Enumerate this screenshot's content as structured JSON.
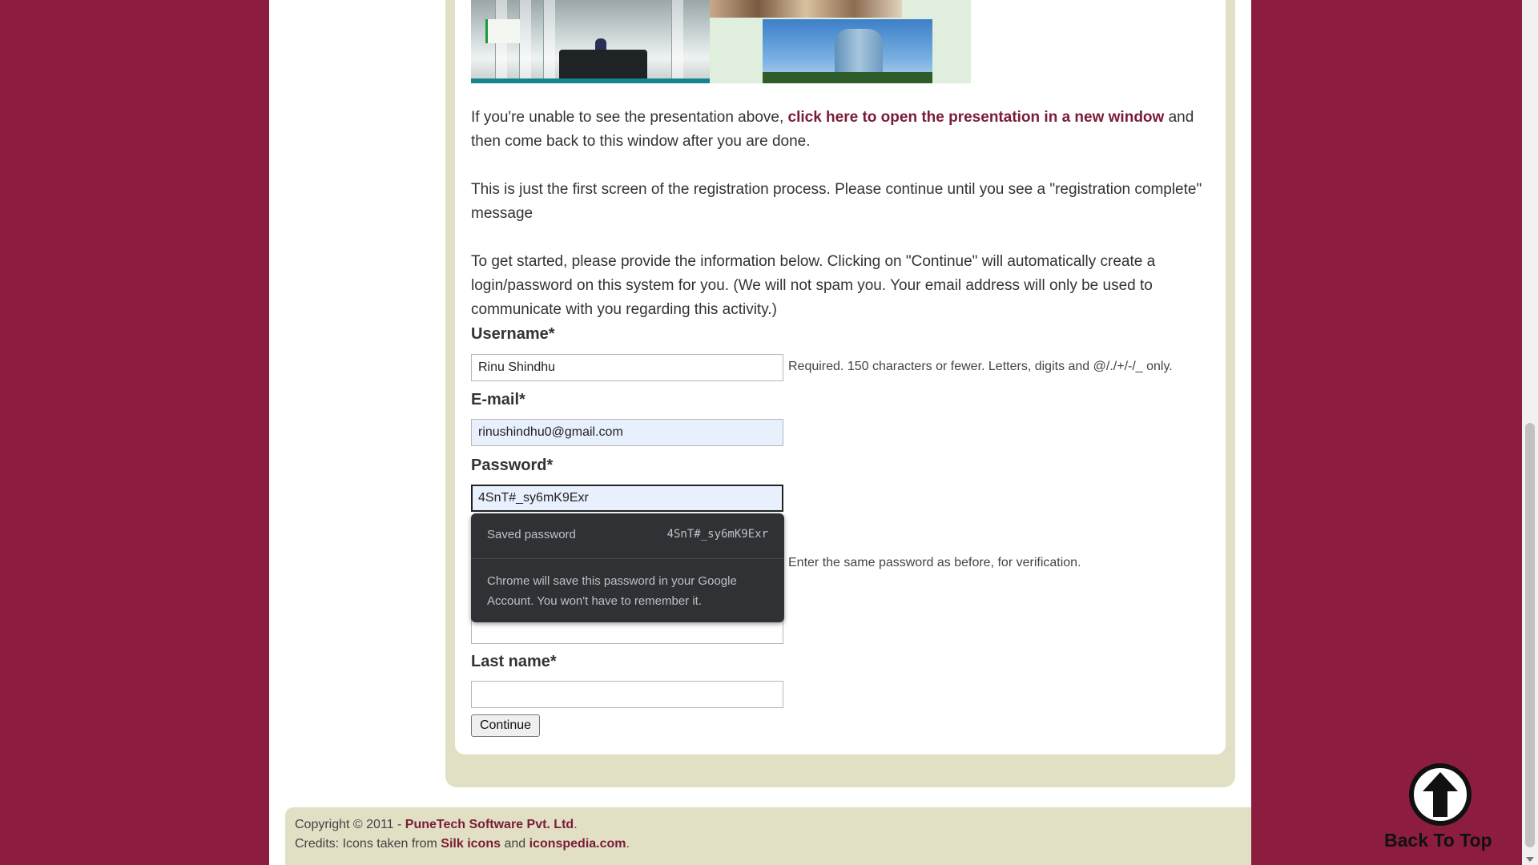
{
  "presentation": {
    "intro_before": "If you're unable to see the presentation above, ",
    "link_text": "click here to open the presentation in a new window",
    "intro_after": " and then come back to this window after you are done."
  },
  "notices": {
    "first_screen": "This is just the first screen of the registration process. Please continue until you see a \"registration complete\" message",
    "get_started": "To get started, please provide the information below. Clicking on \"Continue\" will automatically create a login/password on this system for you. (We will not spam you. Your email address will only be used to communicate with you regarding this activity.)"
  },
  "form": {
    "username": {
      "label": "Username*",
      "value": "Rinu Shindhu",
      "help": "Required. 150 characters or fewer. Letters, digits and @/./+/-/_ only."
    },
    "email": {
      "label": "E-mail*",
      "value": "rinushindhu0@gmail.com"
    },
    "password": {
      "label": "Password*",
      "value": "4SnT#_sy6mK9Exr"
    },
    "password_confirm": {
      "help": "Enter the same password as before, for verification."
    },
    "last_name": {
      "label": "Last name*",
      "value": ""
    },
    "continue_label": "Continue"
  },
  "password_popup": {
    "title": "Saved password",
    "value": "4SnT#_sy6mK9Exr",
    "note": "Chrome will save this password in your Google Account. You won't have to remember it."
  },
  "footer": {
    "copyright_prefix": "Copyright © 2011 - ",
    "company": "PuneTech Software Pvt. Ltd",
    "copyright_suffix": ".",
    "credits_prefix": "Credits: Icons taken from ",
    "silk_icons": "Silk icons",
    "and": " and ",
    "iconspedia": "iconspedia.com",
    "credits_suffix": "."
  },
  "back_to_top": {
    "label": "Back To Top",
    "icon": "up-arrow-circle-icon"
  },
  "colors": {
    "background": "#8c1d3f",
    "panel": "#e1dfc4",
    "link": "#7a1c37"
  }
}
